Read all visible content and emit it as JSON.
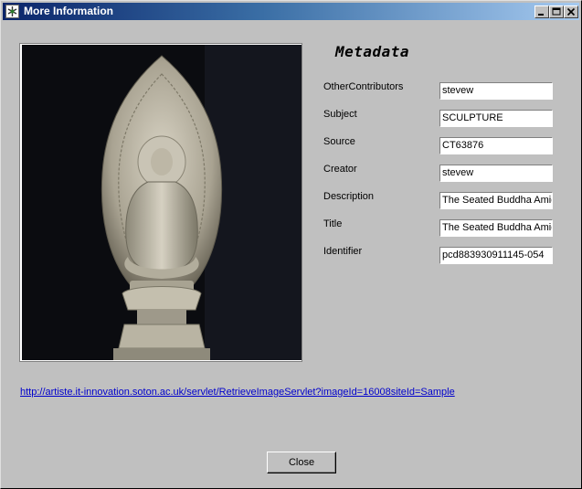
{
  "window": {
    "title": "More Information"
  },
  "metadata": {
    "heading": "Metadata",
    "fields": [
      {
        "label": "OtherContributors",
        "value": "stevew"
      },
      {
        "label": "Subject",
        "value": "SCULPTURE"
      },
      {
        "label": "Source",
        "value": "CT63876"
      },
      {
        "label": "Creator",
        "value": "stevew"
      },
      {
        "label": "Description",
        "value": "The Seated Buddha Amid"
      },
      {
        "label": "Title",
        "value": "The Seated Buddha Amid"
      },
      {
        "label": "Identifier",
        "value": "pcd883930911145-054"
      }
    ]
  },
  "link": {
    "url": "http://artiste.it-innovation.soton.ac.uk/servlet/RetrieveImageServlet?imageId=16008siteId=Sample"
  },
  "buttons": {
    "close_label": "Close"
  },
  "icons": {
    "app": "app-icon",
    "minimize": "minimize-icon",
    "maximize": "maximize-icon",
    "close": "close-icon"
  }
}
